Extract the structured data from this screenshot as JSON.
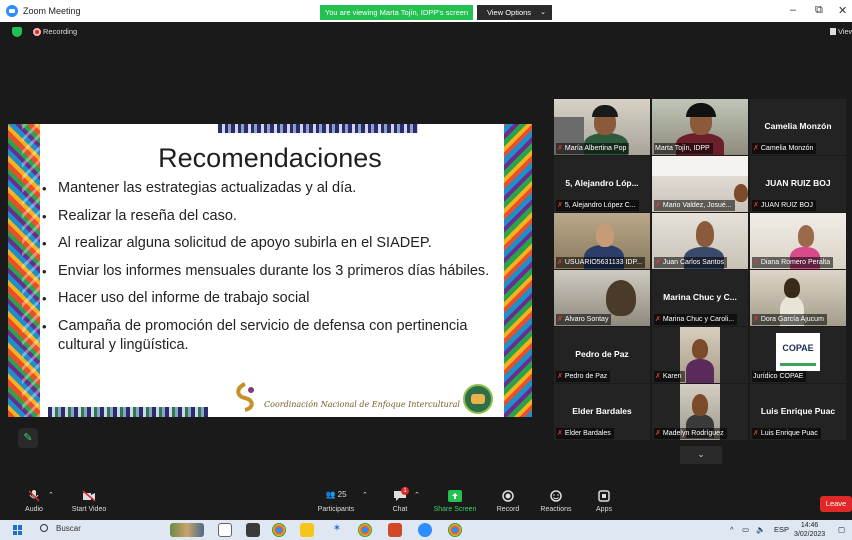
{
  "window": {
    "title": "Zoom Meeting",
    "viewing_banner": "You are viewing Marta Tojín, IDPP's screen",
    "view_options": "View Options",
    "minimize": "–",
    "restore": "⧉",
    "close": "✕"
  },
  "status": {
    "recording": "Recording",
    "view_button": "View"
  },
  "slide": {
    "title": "Recomendaciones",
    "bullets": [
      "Mantener las estrategias actualizadas y al día.",
      "Realizar la reseña del caso.",
      "Al realizar alguna solicitud de apoyo subirla en el SIADEP.",
      "Enviar los informes mensuales durante los 3 primeros días hábiles.",
      "Hacer uso del informe de trabajo social",
      "Campaña de promoción del servicio de defensa con pertinencia cultural y lingüística."
    ],
    "footer": "Coordinación Nacional de Enfoque Intercultural"
  },
  "participants": [
    {
      "label": "María Albertina Pop",
      "center": ""
    },
    {
      "label": "Marta Tojín, IDPP",
      "center": ""
    },
    {
      "label": "Camelia Monzón",
      "center": "Camelia Monzón"
    },
    {
      "label": "5, Alejandro López C...",
      "center": "5, Alejandro Lóp..."
    },
    {
      "label": "Mario Valdez, Josué...",
      "center": ""
    },
    {
      "label": "JUAN RUIZ BOJ",
      "center": "JUAN RUIZ BOJ"
    },
    {
      "label": "USUARIO5631133 IDP...",
      "center": ""
    },
    {
      "label": "Juan Carlos Santos",
      "center": ""
    },
    {
      "label": "Diana Romero Peralta",
      "center": ""
    },
    {
      "label": "Alvaro Sontay",
      "center": ""
    },
    {
      "label": "Marina Chuc y Caroli...",
      "center": "Marina Chuc y C..."
    },
    {
      "label": "Dora García Ajucum",
      "center": ""
    },
    {
      "label": "Pedro de Paz",
      "center": "Pedro de Paz"
    },
    {
      "label": "Karen",
      "center": ""
    },
    {
      "label": "Jurídico COPAE",
      "center": ""
    },
    {
      "label": "Elder Bardales",
      "center": "Elder Bardales"
    },
    {
      "label": "Madelyn Rodríguez",
      "center": ""
    },
    {
      "label": "Luis Enrique Puac",
      "center": "Luis Enrique Puac"
    }
  ],
  "copae_logo": "COPAE",
  "more_tiles": "⌄",
  "toolbar": {
    "audio": "Audio",
    "start_video": "Start Video",
    "participants": "Participants",
    "participants_count": "25",
    "chat": "Chat",
    "chat_badge": "1",
    "share_screen": "Share Screen",
    "record": "Record",
    "reactions": "Reactions",
    "apps": "Apps",
    "leave": "Leave"
  },
  "taskbar": {
    "search": "Buscar",
    "lang": "ESP",
    "time": "14:46",
    "date": "3/02/2023"
  },
  "colors": {
    "zoom_blue": "#2d8cff",
    "share_green": "#23c151",
    "leave_red": "#e02828",
    "active_speaker": "#b9d94a"
  }
}
